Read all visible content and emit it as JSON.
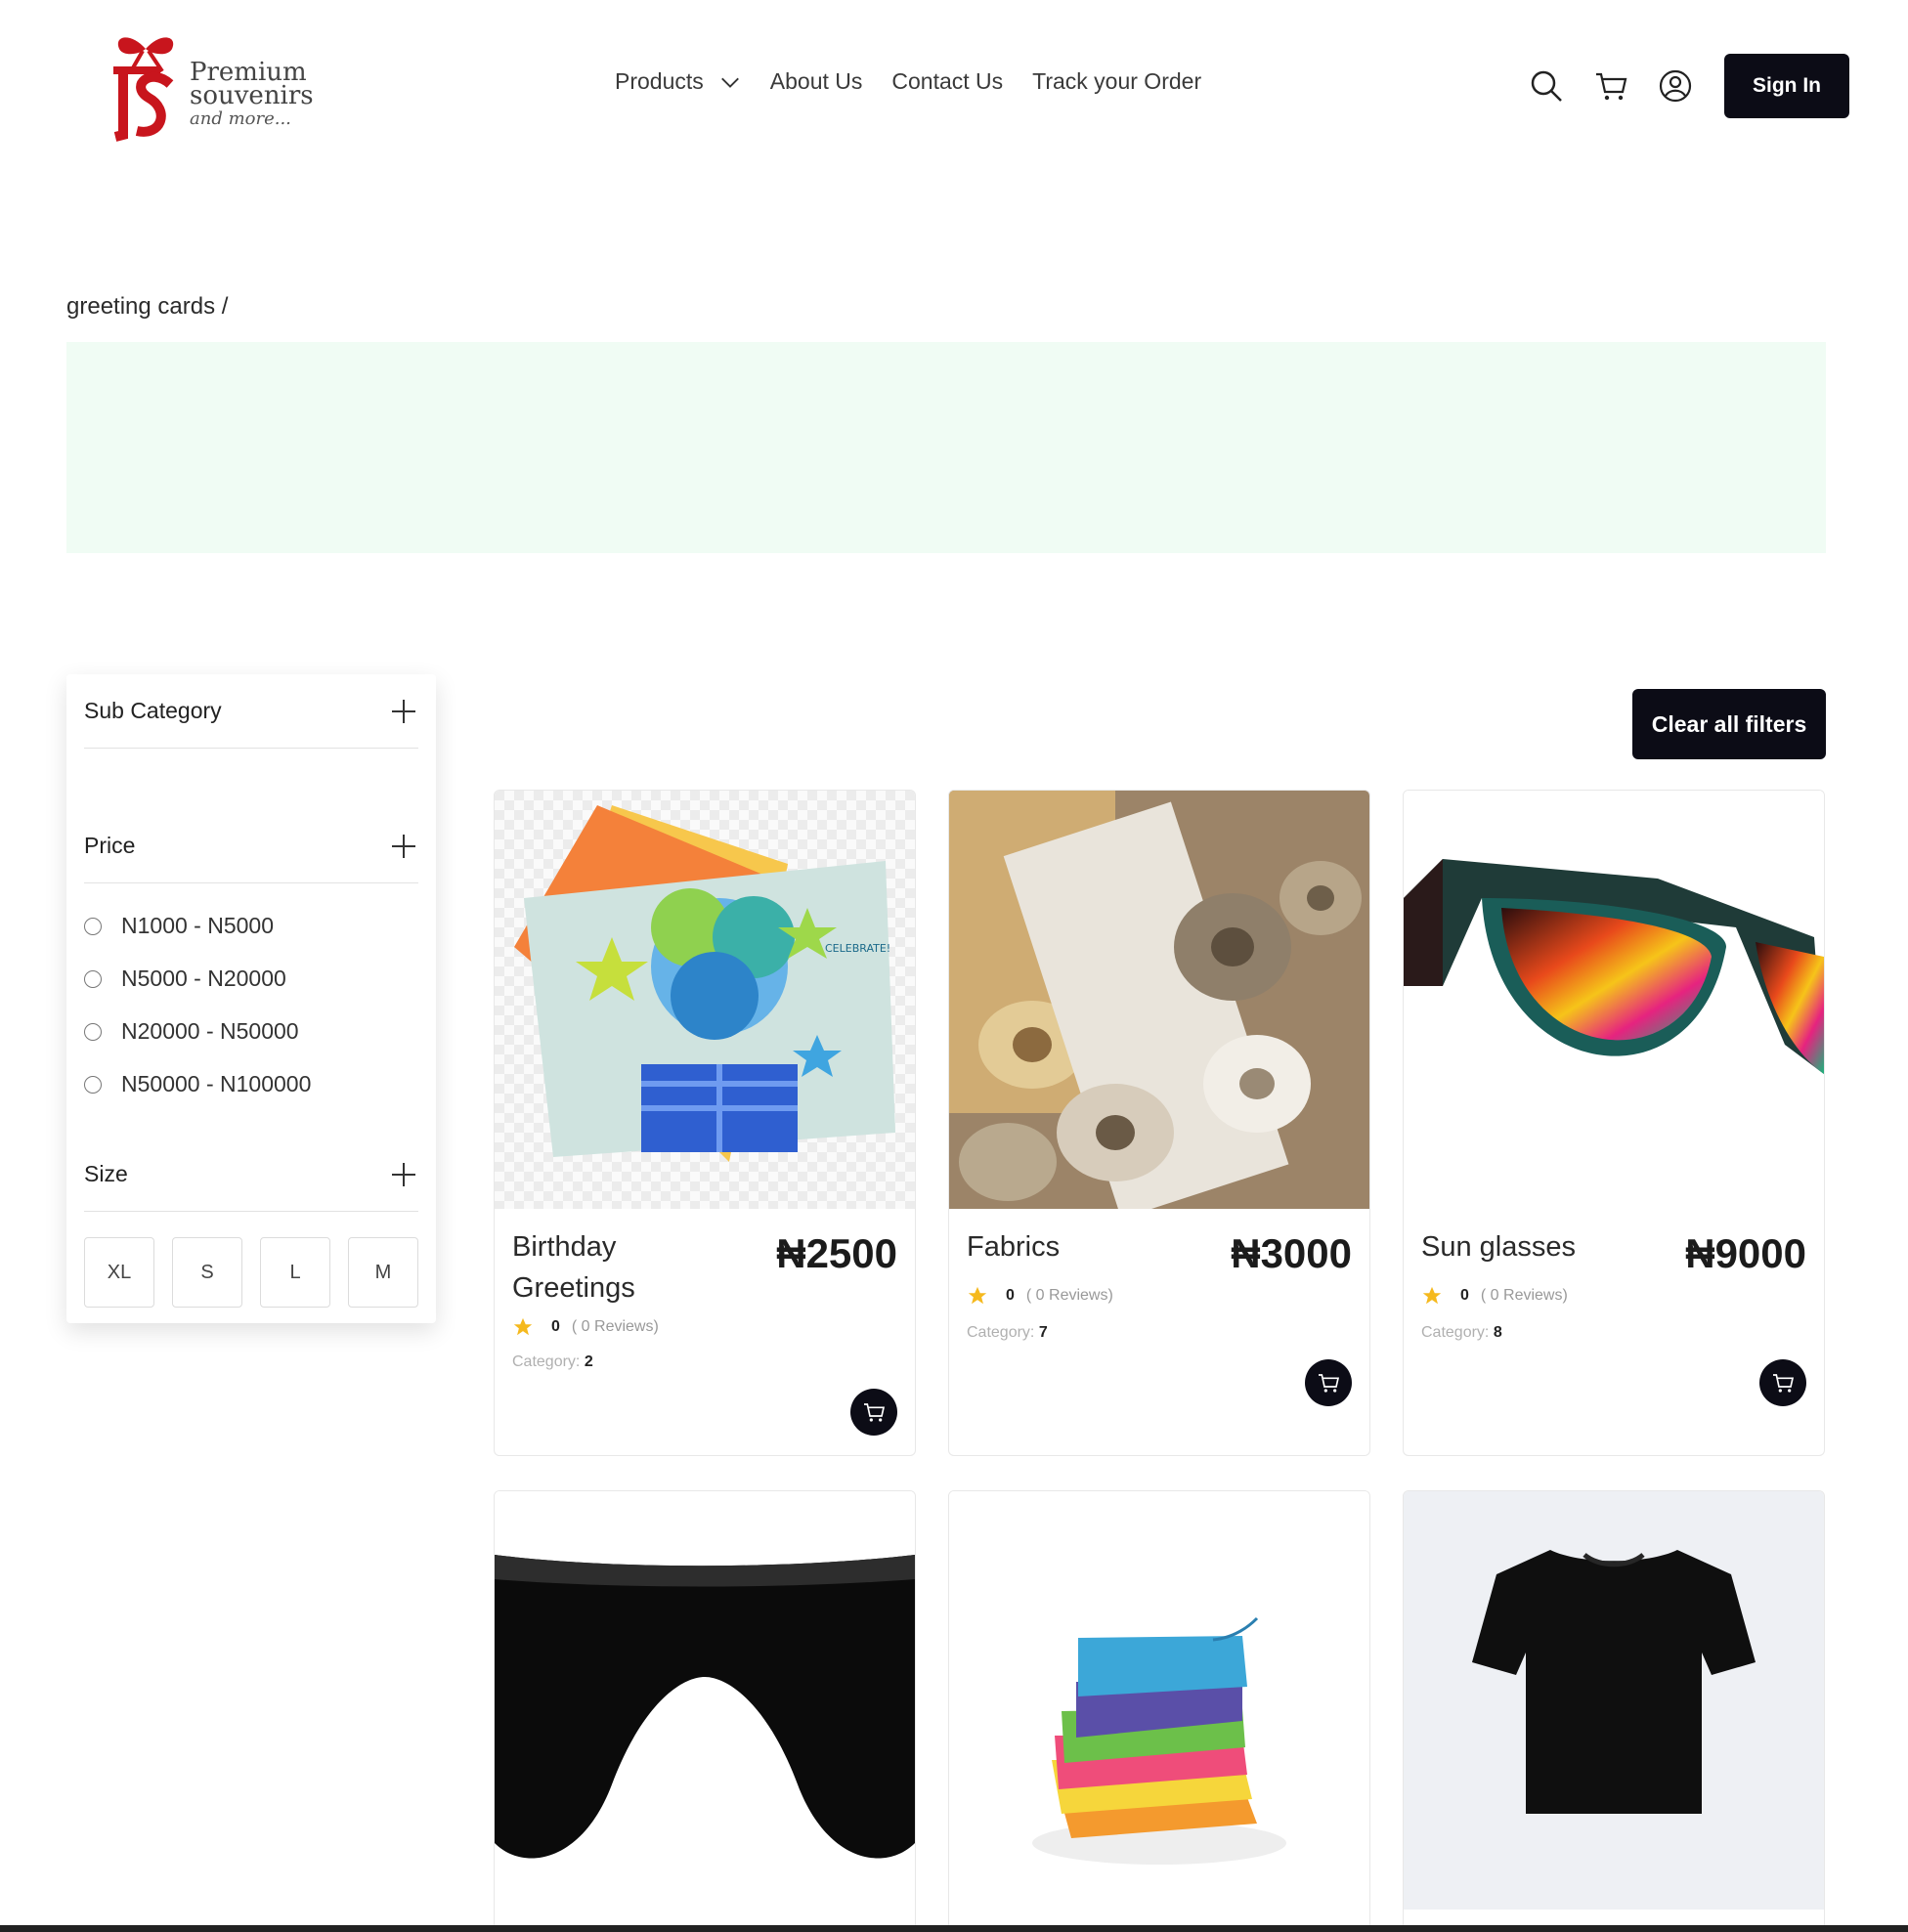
{
  "brand": {
    "line1": "Premium",
    "line2": "souvenirs",
    "line3": "and more..."
  },
  "nav": {
    "items": [
      {
        "label": "Products",
        "has_dropdown": true
      },
      {
        "label": "About Us"
      },
      {
        "label": "Contact Us"
      },
      {
        "label": "Track your Order"
      }
    ]
  },
  "header": {
    "sign_in_label": "Sign In",
    "icons": [
      "search-icon",
      "cart-icon",
      "user-icon"
    ]
  },
  "breadcrumb": {
    "text": "greeting cards /"
  },
  "filters": {
    "sub_category": {
      "label": "Sub Category"
    },
    "price": {
      "label": "Price",
      "options": [
        "N1000 - N5000",
        "N5000 - N20000",
        "N20000 - N50000",
        "N50000 - N100000"
      ]
    },
    "size": {
      "label": "Size",
      "options": [
        "XL",
        "S",
        "L",
        "M"
      ]
    },
    "clear_label": "Clear all filters"
  },
  "products": [
    {
      "name": "Birthday Greetings",
      "price": "₦2500",
      "rating": "0",
      "reviews": "( 0 Reviews)",
      "category_label": "Category:",
      "category": "2"
    },
    {
      "name": "Fabrics",
      "price": "₦3000",
      "rating": "0",
      "reviews": "( 0 Reviews)",
      "category_label": "Category:",
      "category": "7"
    },
    {
      "name": "Sun glasses",
      "price": "₦9000",
      "rating": "0",
      "reviews": "( 0 Reviews)",
      "category_label": "Category:",
      "category": "8"
    }
  ],
  "colors": {
    "primary_dark": "#0c0c16",
    "banner": "#f0fcf4",
    "brand_red": "#c8151d",
    "star": "#f5b91e"
  }
}
